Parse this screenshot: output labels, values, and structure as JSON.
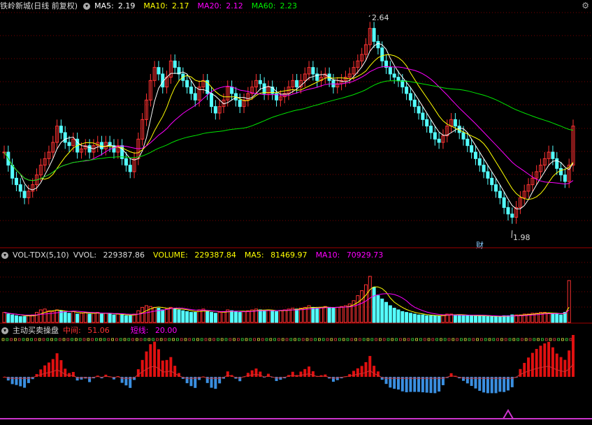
{
  "title": "铁岭新城(日线 前复权)",
  "ma": {
    "ma5_label": "MA5:",
    "ma5": "2.19",
    "ma10_label": "MA10:",
    "ma10": "2.17",
    "ma20_label": "MA20:",
    "ma20": "2.12",
    "ma60_label": "MA60:",
    "ma60": "2.23"
  },
  "high_label": "2.64",
  "low_label": "1.98",
  "cai_label": "财",
  "vol": {
    "name": "VOL-TDX(5,10)",
    "vvol_label": "VVOL:",
    "vvol": "229387.86",
    "volume_label": "VOLUME:",
    "volume": "229387.84",
    "ma5_label": "MA5:",
    "ma5": "81469.97",
    "ma10_label": "MA10:",
    "ma10": "70929.73"
  },
  "ind": {
    "name": "主动买卖操盘",
    "mid_label": "中间:",
    "mid": "51.06",
    "short_label": "短线:",
    "short": "20.00"
  },
  "colors": {
    "up": "#ff3232",
    "down": "#54ffff",
    "ma5": "#ffffff",
    "ma10": "#ffff00",
    "ma20": "#ff00ff",
    "ma60": "#00e600",
    "ind_up": "#e01010",
    "ind_down": "#3a8fe0",
    "ind_line": "#cc33cc"
  },
  "chart_data": {
    "type": "candlestick",
    "price_range": [
      1.98,
      2.64
    ],
    "close": [
      2.22,
      2.18,
      2.14,
      2.12,
      2.1,
      2.08,
      2.1,
      2.12,
      2.15,
      2.18,
      2.2,
      2.22,
      2.25,
      2.3,
      2.28,
      2.25,
      2.24,
      2.26,
      2.22,
      2.23,
      2.24,
      2.22,
      2.24,
      2.25,
      2.23,
      2.25,
      2.24,
      2.22,
      2.24,
      2.2,
      2.18,
      2.16,
      2.2,
      2.26,
      2.32,
      2.38,
      2.44,
      2.48,
      2.46,
      2.42,
      2.45,
      2.5,
      2.48,
      2.46,
      2.44,
      2.42,
      2.4,
      2.38,
      2.42,
      2.44,
      2.4,
      2.36,
      2.34,
      2.36,
      2.38,
      2.42,
      2.4,
      2.38,
      2.36,
      2.38,
      2.4,
      2.42,
      2.44,
      2.43,
      2.4,
      2.42,
      2.4,
      2.38,
      2.39,
      2.4,
      2.42,
      2.44,
      2.42,
      2.44,
      2.46,
      2.48,
      2.46,
      2.44,
      2.45,
      2.46,
      2.44,
      2.42,
      2.43,
      2.44,
      2.45,
      2.46,
      2.48,
      2.5,
      2.52,
      2.55,
      2.6,
      2.56,
      2.54,
      2.5,
      2.48,
      2.46,
      2.45,
      2.44,
      2.42,
      2.4,
      2.38,
      2.36,
      2.34,
      2.32,
      2.3,
      2.28,
      2.26,
      2.25,
      2.27,
      2.3,
      2.32,
      2.3,
      2.28,
      2.26,
      2.24,
      2.22,
      2.2,
      2.18,
      2.16,
      2.14,
      2.12,
      2.1,
      2.08,
      2.05,
      2.03,
      2.02,
      2.05,
      2.08,
      2.1,
      2.12,
      2.14,
      2.16,
      2.18,
      2.2,
      2.22,
      2.2,
      2.17,
      2.15,
      2.13,
      2.18,
      2.3
    ],
    "volume": [
      1.2,
      1.0,
      0.9,
      0.8,
      0.7,
      0.7,
      0.8,
      0.9,
      1.2,
      1.5,
      1.6,
      1.4,
      1.3,
      1.5,
      1.4,
      1.2,
      1.1,
      1.3,
      1.0,
      1.1,
      1.2,
      1.0,
      1.1,
      1.2,
      1.0,
      1.1,
      1.0,
      0.9,
      1.0,
      0.9,
      0.8,
      0.8,
      1.0,
      1.4,
      1.8,
      2.0,
      1.9,
      1.8,
      1.7,
      1.5,
      1.6,
      1.8,
      1.6,
      1.5,
      1.4,
      1.3,
      1.2,
      1.2,
      1.5,
      1.6,
      1.3,
      1.2,
      1.1,
      1.2,
      1.3,
      1.5,
      1.4,
      1.3,
      1.2,
      1.3,
      1.4,
      1.5,
      1.6,
      1.5,
      1.4,
      1.5,
      1.4,
      1.3,
      1.4,
      1.5,
      1.6,
      1.7,
      1.6,
      1.7,
      1.8,
      2.0,
      1.8,
      1.7,
      1.8,
      1.9,
      1.8,
      1.7,
      1.8,
      1.9,
      2.0,
      2.2,
      2.6,
      3.2,
      3.8,
      4.5,
      5.5,
      4.2,
      3.2,
      2.8,
      2.4,
      2.0,
      1.7,
      1.5,
      1.3,
      1.2,
      1.1,
      1.0,
      0.9,
      0.9,
      0.8,
      0.8,
      0.8,
      0.8,
      0.9,
      1.0,
      1.0,
      0.9,
      0.9,
      0.8,
      0.8,
      0.8,
      0.8,
      0.8,
      0.8,
      0.7,
      0.7,
      0.7,
      0.7,
      0.8,
      0.8,
      0.9,
      0.9,
      0.9,
      1.0,
      1.0,
      1.1,
      1.1,
      1.2,
      1.2,
      1.1,
      1.0,
      1.0,
      0.9,
      1.2,
      5.0
    ]
  }
}
